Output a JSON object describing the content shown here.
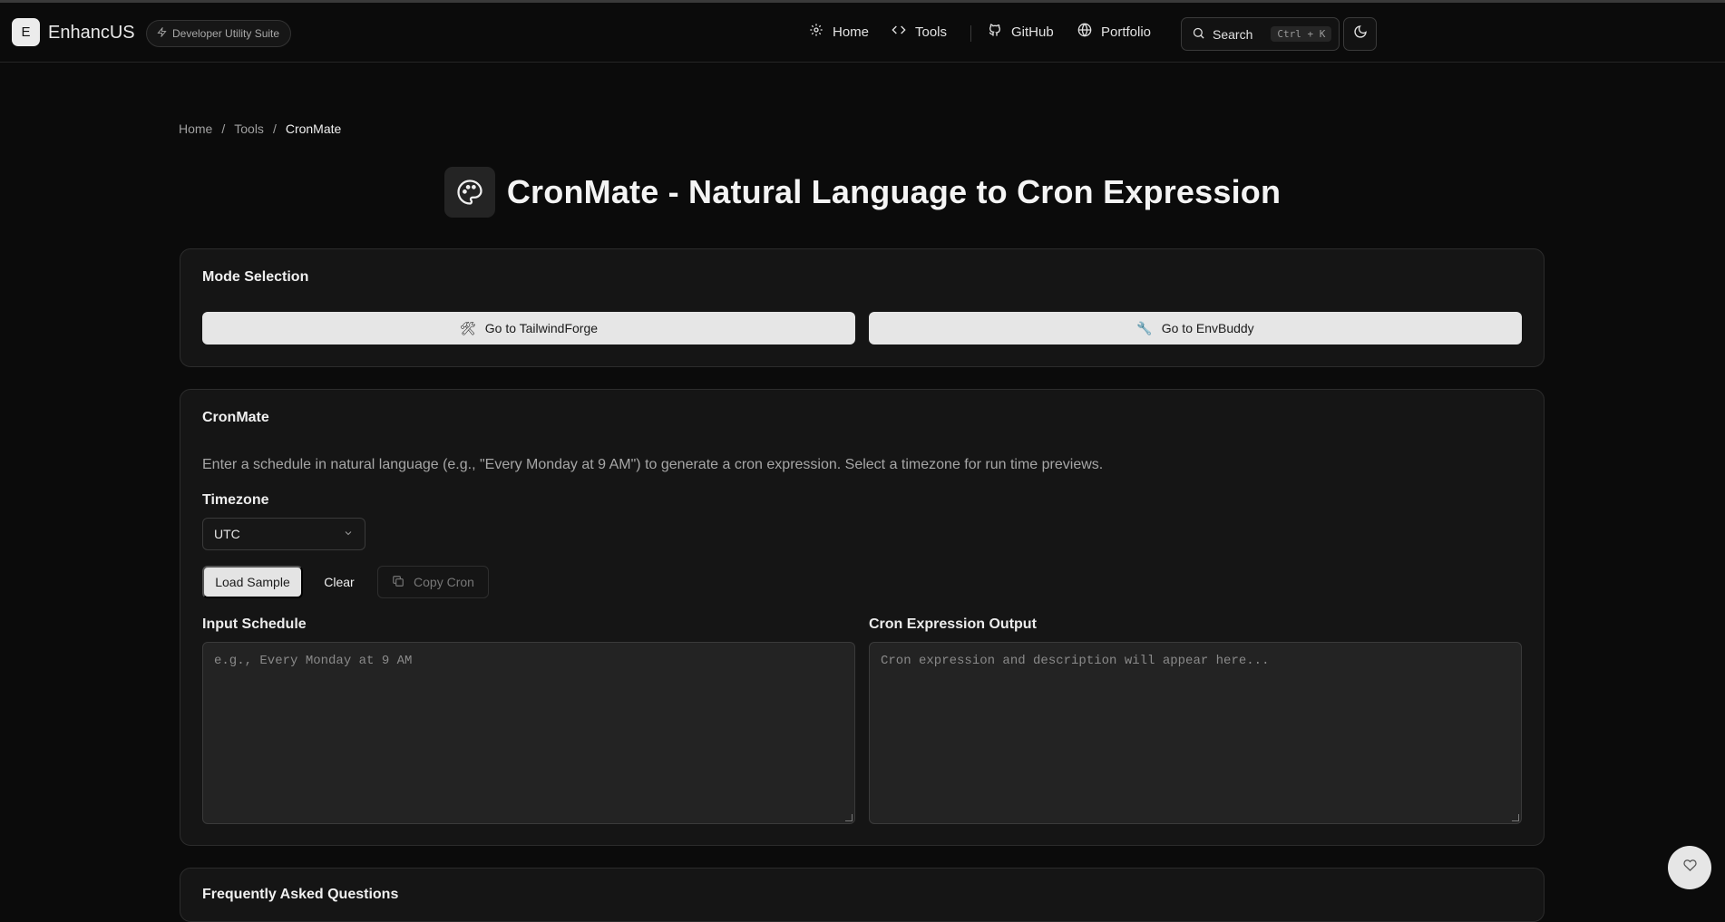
{
  "header": {
    "logo_letter": "E",
    "brand": "EnhancUS",
    "badge": "Developer Utility Suite",
    "nav": [
      {
        "label": "Home",
        "icon": "gear-icon"
      },
      {
        "label": "Tools",
        "icon": "code-icon"
      },
      {
        "label": "GitHub",
        "icon": "github-icon"
      },
      {
        "label": "Portfolio",
        "icon": "globe-icon"
      }
    ],
    "search_label": "Search",
    "search_shortcut": "Ctrl + K"
  },
  "breadcrumb": {
    "items": [
      "Home",
      "Tools",
      "CronMate"
    ],
    "separator": "/"
  },
  "page": {
    "title": "CronMate - Natural Language to Cron Expression",
    "title_icon": "palette-icon"
  },
  "mode_selection": {
    "title": "Mode Selection",
    "buttons": [
      {
        "label": "Go to TailwindForge",
        "icon": "hammer-wrench-icon"
      },
      {
        "label": "Go to EnvBuddy",
        "icon": "wrench-icon"
      }
    ]
  },
  "cronmate": {
    "title": "CronMate",
    "description": "Enter a schedule in natural language (e.g., \"Every Monday at 9 AM\") to generate a cron expression. Select a timezone for run time previews.",
    "timezone_label": "Timezone",
    "timezone_value": "UTC",
    "load_sample_label": "Load Sample",
    "clear_label": "Clear",
    "copy_label": "Copy Cron",
    "input_label": "Input Schedule",
    "input_placeholder": "e.g., Every Monday at 9 AM",
    "output_label": "Cron Expression Output",
    "output_placeholder": "Cron expression and description will appear here..."
  },
  "faq": {
    "title": "Frequently Asked Questions"
  },
  "colors": {
    "background": "#0b0b0b",
    "card": "#151515",
    "primary_button": "#e6e6e6",
    "text": "#ededed"
  }
}
